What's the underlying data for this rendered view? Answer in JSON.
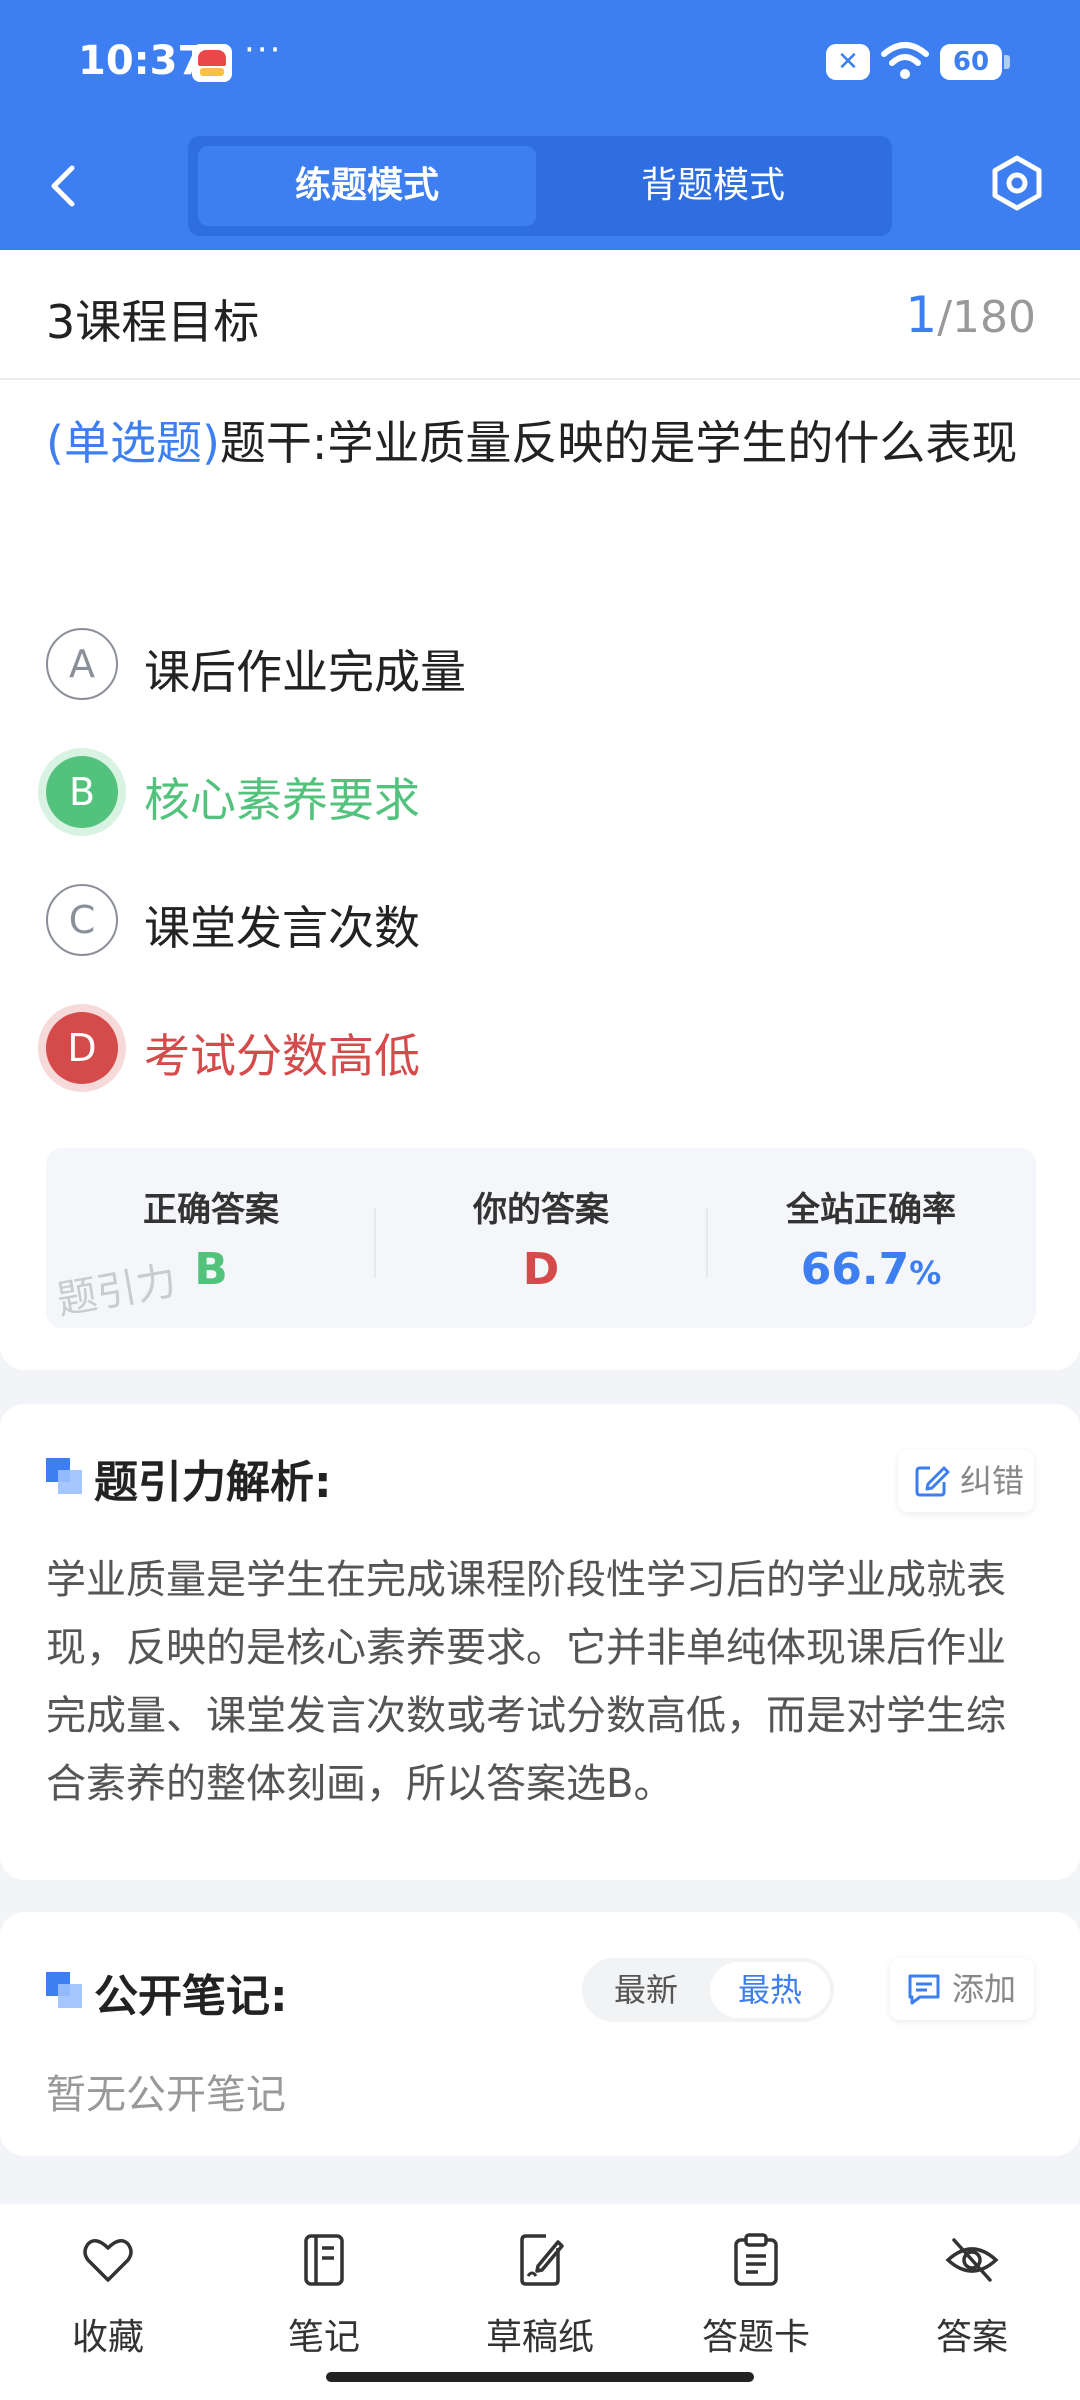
{
  "status_bar": {
    "time": "10:37",
    "dots": "···",
    "battery": "60"
  },
  "header": {
    "tabs": [
      {
        "label": "练题模式",
        "active": true
      },
      {
        "label": "背题模式",
        "active": false
      }
    ]
  },
  "course": {
    "title": "3课程目标",
    "current": "1",
    "total": "/180"
  },
  "question": {
    "type": "(单选题)",
    "stem": "题干:学业质量反映的是学生的什么表现"
  },
  "options": [
    {
      "letter": "A",
      "text": "课后作业完成量",
      "state": "normal"
    },
    {
      "letter": "B",
      "text": "核心素养要求",
      "state": "correct"
    },
    {
      "letter": "C",
      "text": "课堂发言次数",
      "state": "normal"
    },
    {
      "letter": "D",
      "text": "考试分数高低",
      "state": "wrong"
    }
  ],
  "stats": {
    "correct_label": "正确答案",
    "correct_value": "B",
    "yours_label": "你的答案",
    "yours_value": "D",
    "rate_label": "全站正确率",
    "rate_value": "66.7",
    "rate_unit": "%",
    "watermark": "题引力"
  },
  "analysis": {
    "title": "题引力解析:",
    "correct_button": "纠错",
    "text": "学业质量是学生在完成课程阶段性学习后的学业成就表现，反映的是核心素养要求。它并非单纯体现课后作业完成量、课堂发言次数或考试分数高低，而是对学生综合素养的整体刻画，所以答案选B。"
  },
  "notes": {
    "title": "公开笔记:",
    "sort_latest": "最新",
    "sort_hot": "最热",
    "add_button": "添加",
    "empty_text": "暂无公开笔记"
  },
  "bottom_nav": [
    {
      "label": "收藏",
      "icon": "heart-icon"
    },
    {
      "label": "笔记",
      "icon": "notebook-icon"
    },
    {
      "label": "草稿纸",
      "icon": "draft-icon"
    },
    {
      "label": "答题卡",
      "icon": "clipboard-icon"
    },
    {
      "label": "答案",
      "icon": "eye-off-icon"
    }
  ],
  "colors": {
    "brand": "#3d7ff0",
    "correct": "#52c27d",
    "wrong": "#d54a4a"
  }
}
